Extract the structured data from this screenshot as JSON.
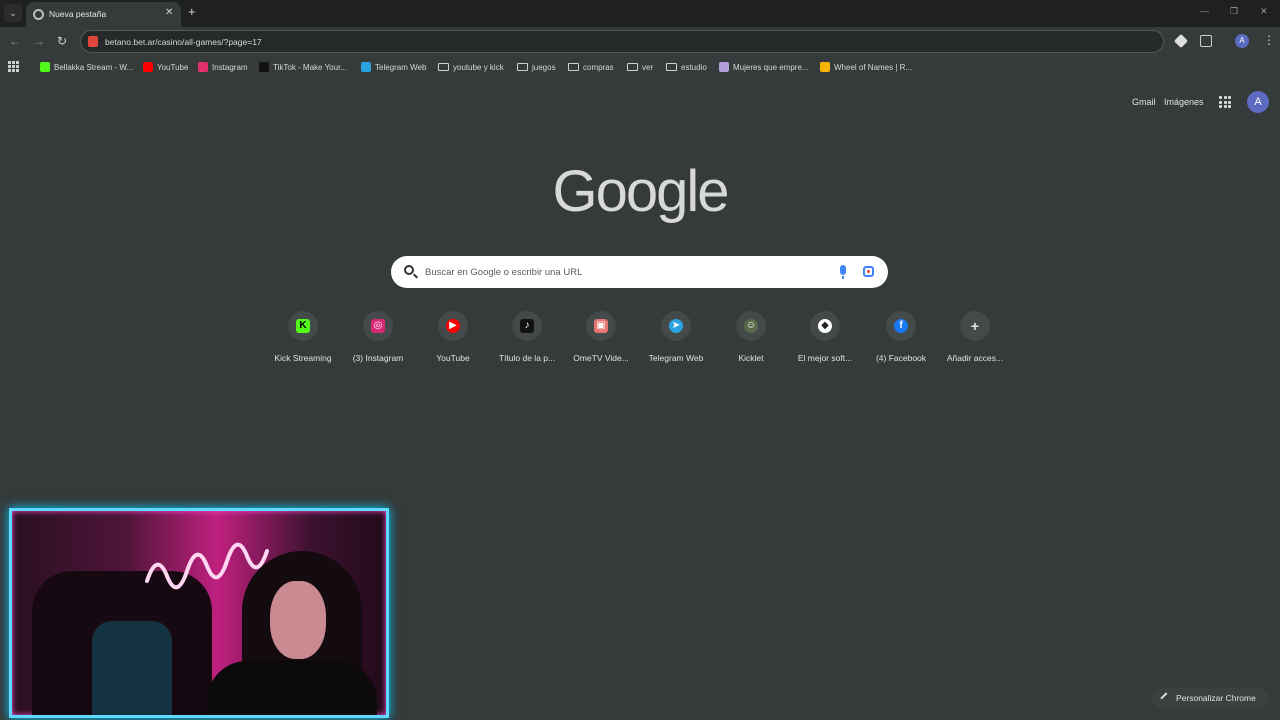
{
  "browser": {
    "tab": {
      "title": "Nueva pestaña",
      "close_glyph": "✕"
    },
    "new_tab_glyph": "+",
    "tab_search_glyph": "⌄",
    "window_controls": [
      "—",
      "❐",
      "✕"
    ],
    "nav": {
      "back": "←",
      "forward": "→",
      "reload": "↻"
    },
    "url": "betano.bet.ar/casino/all-games/?page=17",
    "profile_initial": "A",
    "menu_glyph": "⋮"
  },
  "bookmarks": [
    {
      "label": "Bellakka Stream - W...",
      "icon": "kick-icon",
      "color": "#53fc18"
    },
    {
      "label": "YouTube",
      "icon": "youtube-icon",
      "color": "#ff0000"
    },
    {
      "label": "Instagram",
      "icon": "instagram-icon",
      "color": "#e1306c"
    },
    {
      "label": "TikTok - Make Your...",
      "icon": "tiktok-icon",
      "color": "#111111"
    },
    {
      "label": "Telegram Web",
      "icon": "telegram-icon",
      "color": "#2aa3e0"
    },
    {
      "label": "youtube y kick",
      "icon": "folder-icon",
      "color": ""
    },
    {
      "label": "juegos",
      "icon": "folder-icon",
      "color": ""
    },
    {
      "label": "compras",
      "icon": "folder-icon",
      "color": ""
    },
    {
      "label": "ver",
      "icon": "folder-icon",
      "color": ""
    },
    {
      "label": "estudio",
      "icon": "folder-icon",
      "color": ""
    },
    {
      "label": "Mujeres que empre...",
      "icon": "m-icon",
      "color": "#b39ddb"
    },
    {
      "label": "Wheel of Names | R...",
      "icon": "wheel-icon",
      "color": "#f4b400"
    }
  ],
  "header": {
    "gmail": "Gmail",
    "images": "Imágenes",
    "avatar_initial": "A"
  },
  "logo": "Google",
  "search": {
    "placeholder": "Buscar en Google o escribir una URL"
  },
  "shortcuts": [
    {
      "label": "Kick Streaming",
      "icon": "kick-icon",
      "glyph": "K",
      "color": "#53fc18"
    },
    {
      "label": "(3) Instagram",
      "icon": "instagram-icon",
      "glyph": "◎",
      "color": "#d62976"
    },
    {
      "label": "YouTube",
      "icon": "youtube-icon",
      "glyph": "▶",
      "color": "#ff0000"
    },
    {
      "label": "Título de la p...",
      "icon": "tiktok-icon",
      "glyph": "♪",
      "color": "#111111"
    },
    {
      "label": "OmeTV Vide...",
      "icon": "ometv-icon",
      "glyph": "▣",
      "color": "#e57373"
    },
    {
      "label": "Telegram Web",
      "icon": "telegram-icon",
      "glyph": "➤",
      "color": "#2aa3e0"
    },
    {
      "label": "Kicklet",
      "icon": "kicklet-icon",
      "glyph": "☺",
      "color": "#5b6b4a"
    },
    {
      "label": "El mejor soft...",
      "icon": "software-icon",
      "glyph": "◆",
      "color": "#ffffff"
    },
    {
      "label": "(4) Facebook",
      "icon": "facebook-icon",
      "glyph": "f",
      "color": "#1877f2"
    },
    {
      "label": "Añadir acces...",
      "icon": "plus-icon",
      "glyph": "+",
      "color": ""
    }
  ],
  "customize": {
    "label": "Personalizar Chrome"
  }
}
